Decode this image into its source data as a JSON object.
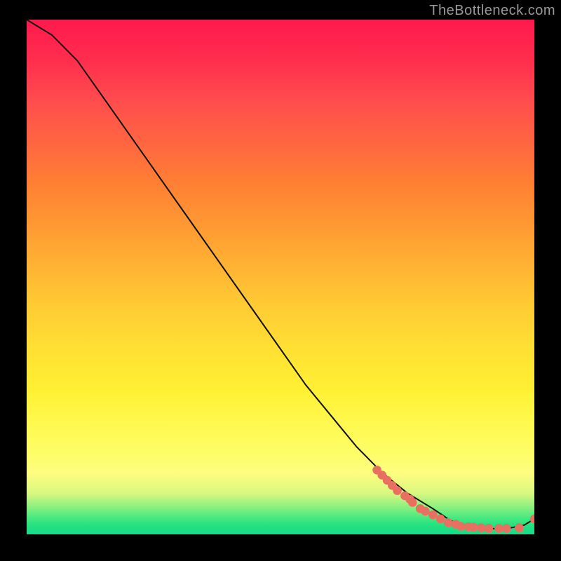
{
  "watermark": "TheBottleneck.com",
  "chart_data": {
    "type": "line",
    "title": "",
    "xlabel": "",
    "ylabel": "",
    "series": [
      {
        "name": "curve",
        "x": [
          0.0,
          0.05,
          0.1,
          0.15,
          0.2,
          0.25,
          0.3,
          0.35,
          0.4,
          0.45,
          0.5,
          0.55,
          0.6,
          0.65,
          0.7,
          0.75,
          0.8,
          0.83,
          0.85,
          0.88,
          0.9,
          0.92,
          0.95,
          0.98,
          1.0
        ],
        "y": [
          1.0,
          0.97,
          0.92,
          0.85,
          0.78,
          0.71,
          0.64,
          0.57,
          0.5,
          0.43,
          0.36,
          0.29,
          0.23,
          0.17,
          0.12,
          0.08,
          0.05,
          0.03,
          0.02,
          0.015,
          0.012,
          0.011,
          0.012,
          0.018,
          0.03
        ]
      },
      {
        "name": "dots",
        "x": [
          0.69,
          0.7,
          0.71,
          0.72,
          0.73,
          0.745,
          0.755,
          0.76,
          0.775,
          0.785,
          0.8,
          0.815,
          0.83,
          0.845,
          0.855,
          0.87,
          0.88,
          0.895,
          0.91,
          0.93,
          0.945,
          0.97,
          1.0
        ],
        "y": [
          0.125,
          0.115,
          0.105,
          0.095,
          0.085,
          0.075,
          0.068,
          0.062,
          0.05,
          0.045,
          0.038,
          0.03,
          0.023,
          0.02,
          0.016,
          0.015,
          0.014,
          0.013,
          0.012,
          0.012,
          0.012,
          0.013,
          0.03
        ]
      }
    ],
    "xlim": [
      0,
      1
    ],
    "ylim": [
      0,
      1
    ],
    "colors": {
      "curve_stroke": "#111111",
      "dot_fill": "#e87060"
    }
  }
}
